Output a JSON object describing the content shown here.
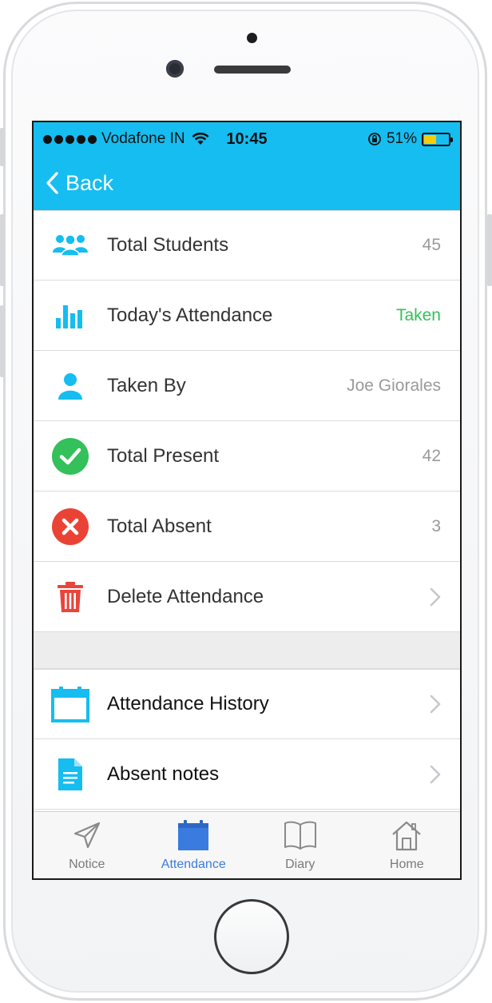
{
  "status_bar": {
    "carrier": "Vodafone IN",
    "time": "10:45",
    "battery_percent": "51%",
    "battery_level": 0.51
  },
  "nav": {
    "back_label": "Back"
  },
  "summary_rows": [
    {
      "icon": "students-icon",
      "label": "Total Students",
      "value": "45"
    },
    {
      "icon": "bar-chart-icon",
      "label": "Today's Attendance",
      "value": "Taken"
    },
    {
      "icon": "person-icon",
      "label": "Taken By",
      "value": "Joe Giorales"
    },
    {
      "icon": "check-circle-icon",
      "label": "Total Present",
      "value": "42"
    },
    {
      "icon": "x-circle-icon",
      "label": "Total Absent",
      "value": "3"
    },
    {
      "icon": "trash-icon",
      "label": "Delete Attendance",
      "value": ""
    }
  ],
  "links": [
    {
      "icon": "calendar-icon",
      "label": "Attendance History"
    },
    {
      "icon": "document-icon",
      "label": "Absent notes"
    }
  ],
  "tabs": [
    {
      "icon": "paper-plane-icon",
      "label": "Notice",
      "active": false
    },
    {
      "icon": "calendar-icon",
      "label": "Attendance",
      "active": true
    },
    {
      "icon": "book-icon",
      "label": "Diary",
      "active": false
    },
    {
      "icon": "house-icon",
      "label": "Home",
      "active": false
    }
  ],
  "colors": {
    "accent": "#15bdf0",
    "taken_green": "#34c05a",
    "present_green": "#34c05a",
    "absent_red": "#ea4335",
    "delete_red": "#e8453c",
    "active_tab": "#3a7be0"
  }
}
